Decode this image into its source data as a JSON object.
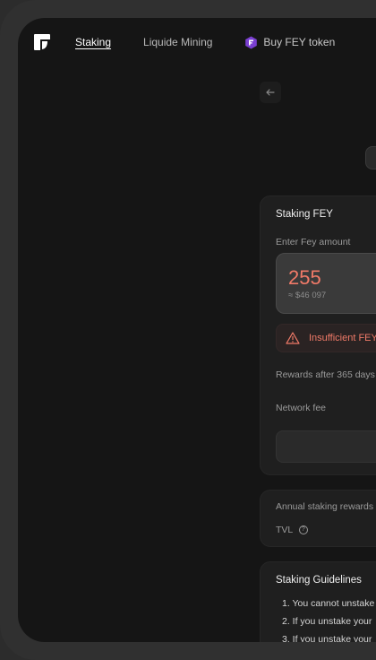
{
  "nav": {
    "logo_icon": "fey-logo",
    "links": [
      "Staking",
      "Liquide Mining"
    ],
    "buy_label": "Buy FEY token",
    "buy_icon": "fey-token-badge-icon"
  },
  "staking_card": {
    "title": "Staking FEY",
    "amount_label": "Enter Fey amount",
    "amount_value": "255",
    "amount_usd": "≈ $46 097",
    "warning": "Insufficient FEY",
    "rewards_label": "Rewards after 365 days",
    "network_fee_label": "Network fee"
  },
  "stats_card": {
    "annual_label": "Annual staking rewards",
    "tvl_label": "TVL",
    "tvl_help": "?"
  },
  "guidelines": {
    "title": "Staking Guidelines",
    "items": [
      "1. You cannot unstake",
      "2. If you unstake your",
      "3. If you unstake your"
    ]
  },
  "colors": {
    "accent_warning": "#f07a68",
    "token_badge": "#7a3fd1"
  }
}
